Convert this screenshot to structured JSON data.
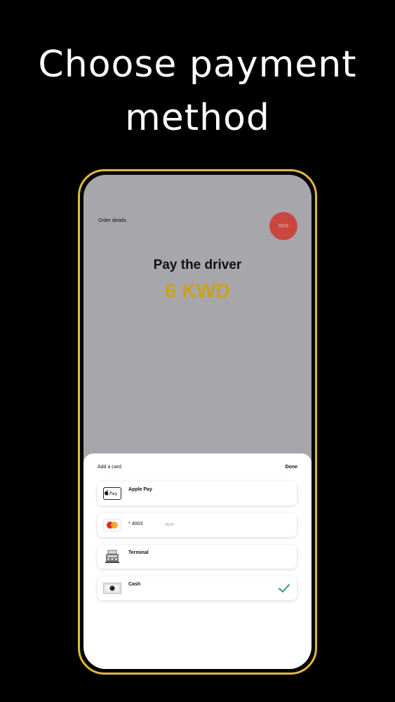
{
  "headline": {
    "line1": "Choose payment",
    "line2": "method"
  },
  "screen": {
    "order_details": "Order details",
    "sos": "SOS",
    "pay_title": "Pay the driver",
    "amount": "6 KWD"
  },
  "sheet": {
    "add_card": "Add a card",
    "done": "Done",
    "methods": [
      {
        "label": "Apple Pay",
        "icon": "apple-pay-icon"
      },
      {
        "label": "* 4003",
        "sub": "08/25",
        "icon": "mastercard-icon"
      },
      {
        "label": "Terminal",
        "icon": "terminal-icon"
      },
      {
        "label": "Cash",
        "icon": "cash-icon",
        "selected": true
      }
    ]
  },
  "colors": {
    "accent": "#e2b93b",
    "amount": "#c9a21c",
    "sos": "#c9473e",
    "check": "#2e9a6a"
  }
}
